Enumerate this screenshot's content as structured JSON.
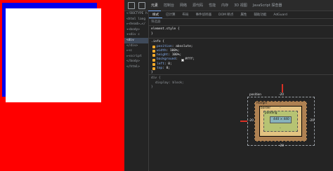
{
  "devtools": {
    "tabs": [
      {
        "label": "元素",
        "active": true
      },
      {
        "label": "控制台",
        "active": false
      },
      {
        "label": "网络",
        "active": false
      },
      {
        "label": "源代码",
        "active": false
      },
      {
        "label": "性能",
        "active": false
      },
      {
        "label": "内存",
        "active": false
      },
      {
        "label": "3D 视图",
        "active": false
      },
      {
        "label": "JavaScript 探查器",
        "active": false
      }
    ],
    "subtabs": [
      {
        "label": "样式",
        "active": true
      },
      {
        "label": "已计算",
        "active": false
      },
      {
        "label": "布局",
        "active": false
      },
      {
        "label": "事件侦听器",
        "active": false
      },
      {
        "label": "DOM 断点",
        "active": false
      },
      {
        "label": "属性",
        "active": false
      },
      {
        "label": "辅助功能",
        "active": false
      },
      {
        "label": "AdGuard",
        "active": false
      }
    ],
    "filter_placeholder": "筛选器",
    "tree": [
      "<!DOCTYPE h",
      "<html lang",
      "▸<head>…</",
      "▾<body>",
      "  ▾<div c",
      "      <div",
      "  </div>",
      "  ▸<c",
      "  ▸<script",
      "</body>",
      "</html>"
    ],
    "element_style_selector": "element.style {",
    "element_style_close": "}",
    "rule_selector": ".info {",
    "declarations": [
      {
        "prop": "position",
        "value": "absolute;"
      },
      {
        "prop": "width",
        "value": "100%;"
      },
      {
        "prop": "height",
        "value": "100%;"
      },
      {
        "prop": "background",
        "value": "#fff;"
      },
      {
        "prop": "left",
        "value": "0;"
      },
      {
        "prop": "top",
        "value": "0;"
      }
    ],
    "rule_close": "}",
    "ua_selector": "div {",
    "ua_decl": "display: block;",
    "ua_close": "}",
    "box_model": {
      "position_label": "position",
      "position_top": "-20",
      "position_left": "-20",
      "position_right": "-20",
      "position_bottom": "-20",
      "margin_label": "margin",
      "margin_value": "-",
      "border_label": "border",
      "border_value": "-",
      "padding_label": "padding",
      "padding_value": "-",
      "content_value": "440 × 440"
    }
  }
}
